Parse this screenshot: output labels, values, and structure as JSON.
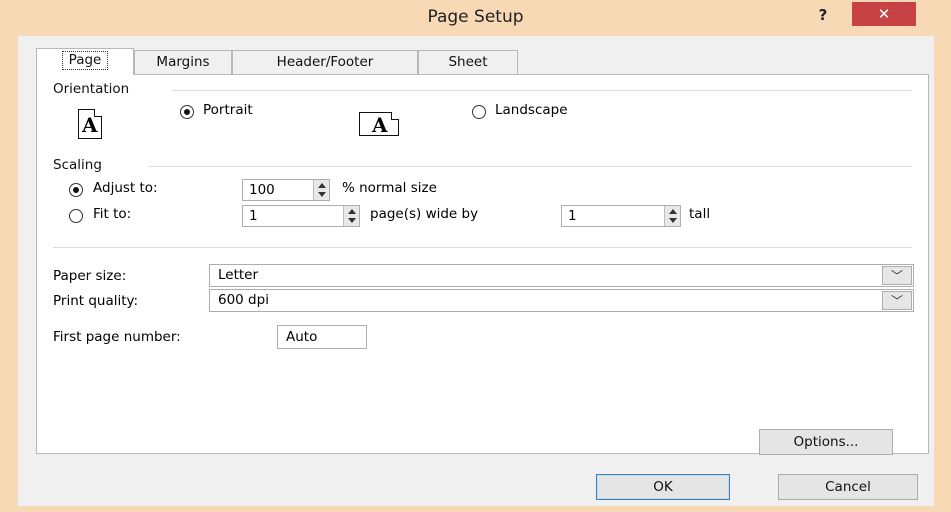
{
  "window": {
    "title": "Page Setup",
    "help_label": "?",
    "close_label": "✕"
  },
  "tabs": [
    {
      "label": "Page"
    },
    {
      "label": "Margins"
    },
    {
      "label": "Header/Footer"
    },
    {
      "label": "Sheet"
    }
  ],
  "orientation": {
    "label": "Orientation",
    "portrait_label": "Portrait",
    "landscape_label": "Landscape",
    "icon_glyph": "A",
    "selected": "portrait"
  },
  "scaling": {
    "label": "Scaling",
    "adjust_label": "Adjust to:",
    "adjust_value": "100",
    "adjust_suffix": "% normal size",
    "fit_label": "Fit to:",
    "fit_wide_value": "1",
    "fit_wide_suffix": "page(s) wide by",
    "fit_tall_value": "1",
    "fit_tall_suffix": "tall",
    "selected": "adjust"
  },
  "paper_size": {
    "label": "Paper size:",
    "value": "Letter"
  },
  "print_quality": {
    "label": "Print quality:",
    "value": "600 dpi"
  },
  "first_page": {
    "label": "First page number:",
    "value": "Auto"
  },
  "buttons": {
    "options": "Options...",
    "ok": "OK",
    "cancel": "Cancel"
  },
  "icons": {
    "dropdown": "chevron-down-icon",
    "spin": "spinner-arrows-icon",
    "close": "close-icon",
    "help": "help-icon"
  }
}
